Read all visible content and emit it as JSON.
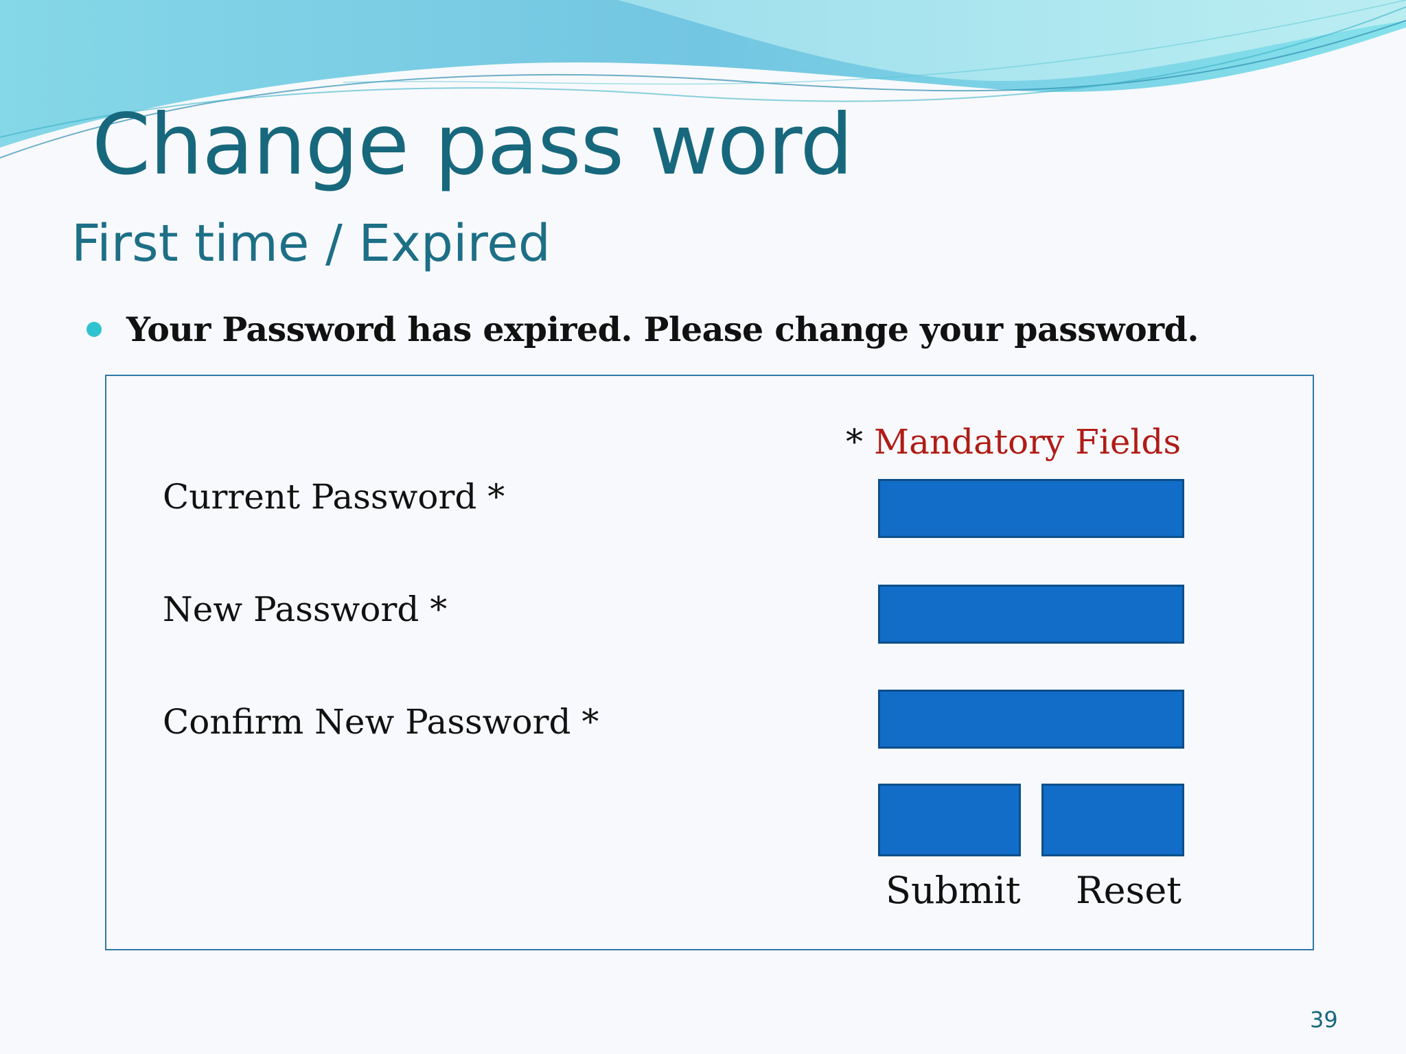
{
  "slide": {
    "title": "Change pass word",
    "subtitle": "First time / Expired",
    "bullet": "Your Password has expired. Please change your password.",
    "page_number": "39",
    "colors": {
      "title": "#17687d",
      "accent_teal": "#2fc3d0",
      "field_blue": "#116dc7",
      "mandatory_red": "#b01c16"
    }
  },
  "form": {
    "mandatory_star": "*",
    "mandatory_text": "Mandatory Fields",
    "fields": [
      {
        "label": "Current Password *"
      },
      {
        "label": "New Password *"
      },
      {
        "label": "Confirm New Password *"
      }
    ],
    "buttons": {
      "submit": "Submit",
      "reset": "Reset"
    }
  }
}
